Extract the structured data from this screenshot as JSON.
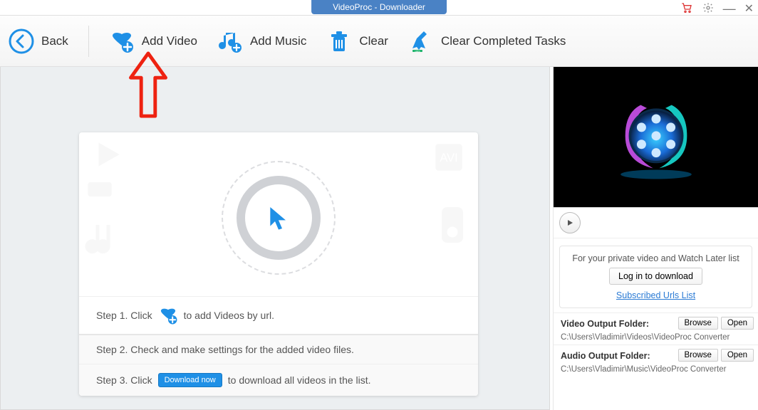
{
  "title": "VideoProc - Downloader",
  "toolbar": {
    "back": "Back",
    "add_video": "Add Video",
    "add_music": "Add Music",
    "clear": "Clear",
    "clear_completed": "Clear Completed Tasks"
  },
  "drop": {
    "step1_a": "Step 1. Click",
    "step1_b": "to add Videos by url.",
    "step2": "Step 2. Check and make settings for the added video files.",
    "step3_a": "Step 3. Click",
    "step3_b": "to download all videos in the list.",
    "download_badge": "Download now"
  },
  "side": {
    "private_text": "For your private video and Watch Later list",
    "login_btn": "Log in to download",
    "subscribed_link": "Subscribed Urls List",
    "video_folder_label": "Video Output Folder:",
    "video_folder_path": "C:\\Users\\Vladimir\\Videos\\VideoProc Converter",
    "audio_folder_label": "Audio Output Folder:",
    "audio_folder_path": "C:\\Users\\Vladimir\\Music\\VideoProc Converter",
    "browse": "Browse",
    "open": "Open"
  }
}
